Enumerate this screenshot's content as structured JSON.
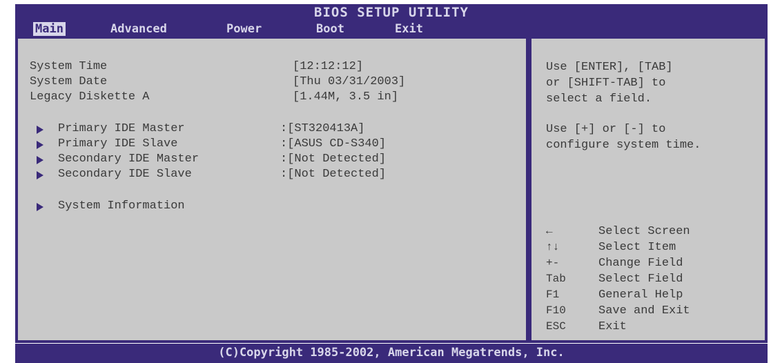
{
  "header": {
    "title": "BIOS SETUP UTILITY",
    "tabs": [
      {
        "label": "Main"
      },
      {
        "label": "Advanced"
      },
      {
        "label": "Power"
      },
      {
        "label": "Boot"
      },
      {
        "label": "Exit"
      }
    ]
  },
  "main": {
    "items": [
      {
        "label": "System Time",
        "value": "[12:12:12]"
      },
      {
        "label": "System Date",
        "value": "[Thu 03/31/2003]"
      },
      {
        "label": "Legacy Diskette A",
        "value": "[1.44M, 3.5 in]"
      }
    ],
    "submenus": [
      {
        "label": "Primary IDE Master",
        "value": ":[ST320413A]"
      },
      {
        "label": "Primary IDE Slave",
        "value": ":[ASUS CD-S340]"
      },
      {
        "label": "Secondary IDE Master",
        "value": ":[Not Detected]"
      },
      {
        "label": "Secondary IDE Slave",
        "value": ":[Not Detected]"
      },
      {
        "label": "System Information",
        "value": ""
      }
    ]
  },
  "help": {
    "lines1": [
      "Use [ENTER], [TAB]",
      "or [SHIFT-TAB] to",
      "select a field."
    ],
    "lines2": [
      "Use [+] or [-] to",
      "configure system time."
    ],
    "keys": [
      {
        "key": "←",
        "desc": "Select Screen"
      },
      {
        "key": "↑↓",
        "desc": "Select Item"
      },
      {
        "key": "+-",
        "desc": "Change Field"
      },
      {
        "key": "Tab",
        "desc": "Select Field"
      },
      {
        "key": "F1",
        "desc": "General Help"
      },
      {
        "key": "F10",
        "desc": "Save and Exit"
      },
      {
        "key": "ESC",
        "desc": "Exit"
      }
    ]
  },
  "footer": {
    "copyright": "(C)Copyright 1985-2002, American Megatrends, Inc."
  },
  "colors": {
    "header_bg": "#3a2a7a",
    "panel_bg": "#c9c9c9",
    "text": "#3a3a3a",
    "header_text": "#d8d6ea"
  }
}
